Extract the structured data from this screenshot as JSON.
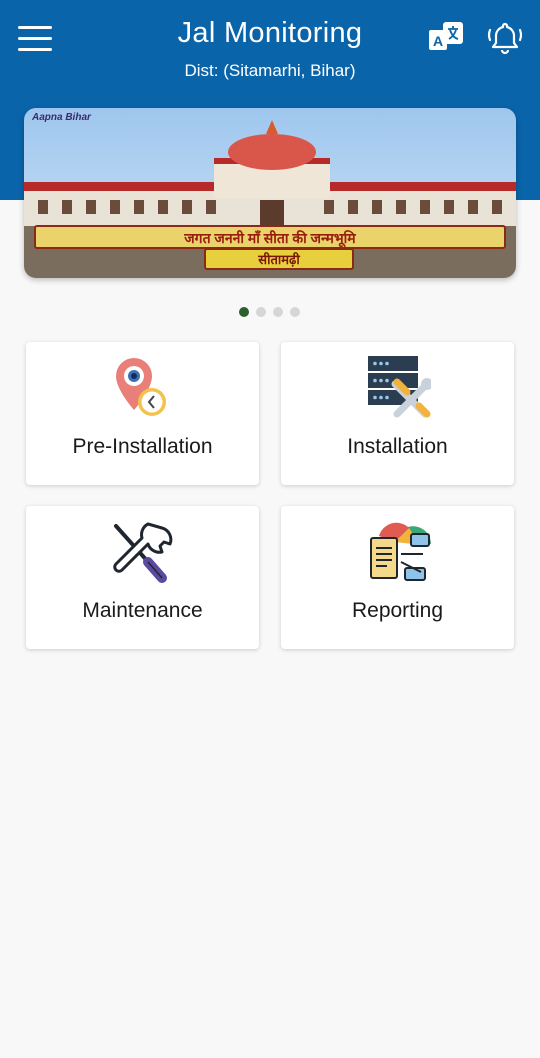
{
  "header": {
    "title": "Jal Monitoring",
    "subtitle": "Dist: (Sitamarhi, Bihar)",
    "background": "#0a64a9",
    "icons": [
      "menu-icon",
      "translate-icon",
      "bell-icon"
    ]
  },
  "banner": {
    "logo_text": "Aapna Bihar",
    "caption": "जगत जननी माँ सीता की जन्मभूमि",
    "subcaption": "सीतामढ़ी",
    "active_slide": 1,
    "slide_count": 4
  },
  "tiles": [
    {
      "label": "Pre-Installation",
      "icon": "location-clock-icon"
    },
    {
      "label": "Installation",
      "icon": "server-tools-icon"
    },
    {
      "label": "Maintenance",
      "icon": "wrench-screwdriver-icon"
    },
    {
      "label": "Reporting",
      "icon": "report-chart-icon"
    }
  ]
}
